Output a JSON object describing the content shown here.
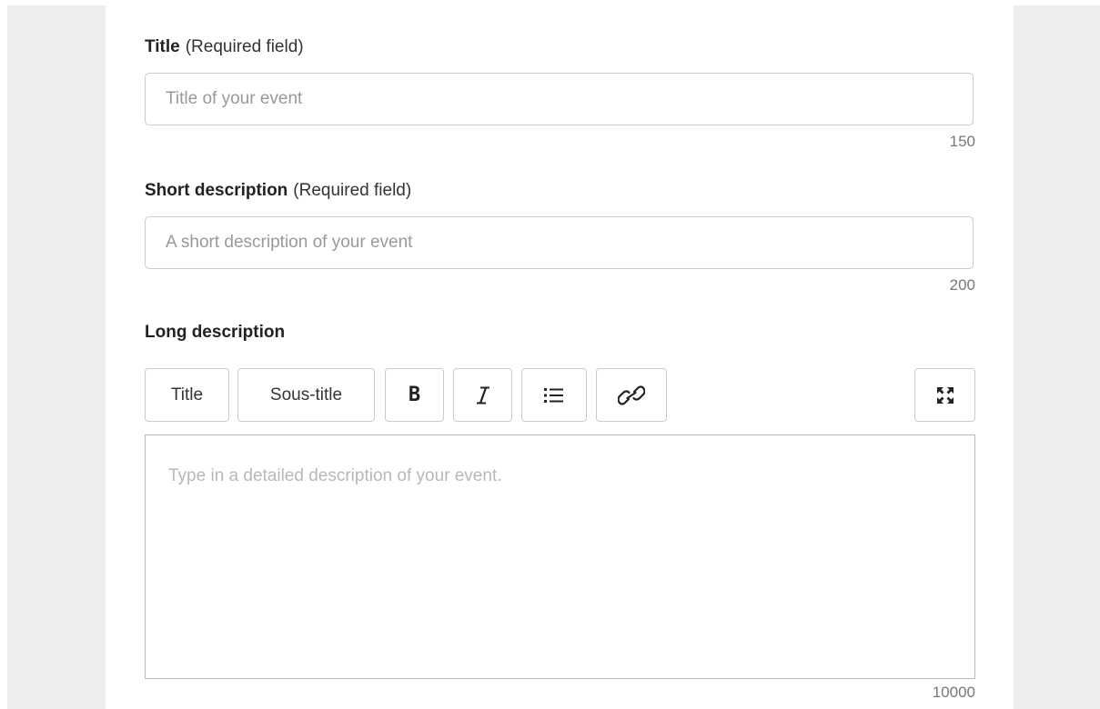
{
  "form": {
    "title_field": {
      "label": "Title",
      "note": "(Required field)",
      "placeholder": "Title of your event",
      "counter": "150"
    },
    "short_desc_field": {
      "label": "Short description",
      "note": "(Required field)",
      "placeholder": "A short description of your event",
      "counter": "200"
    },
    "long_desc_field": {
      "label": "Long description",
      "toolbar": {
        "title_label": "Title",
        "subtitle_label": "Sous-title",
        "bold_label": "B",
        "bold_icon": "bold-icon",
        "italic_icon": "italic-icon",
        "list_icon": "list-icon",
        "link_icon": "link-icon",
        "fullscreen_icon": "fullscreen-icon"
      },
      "placeholder": "Type in a detailed description of your event.",
      "counter": "10000"
    }
  }
}
